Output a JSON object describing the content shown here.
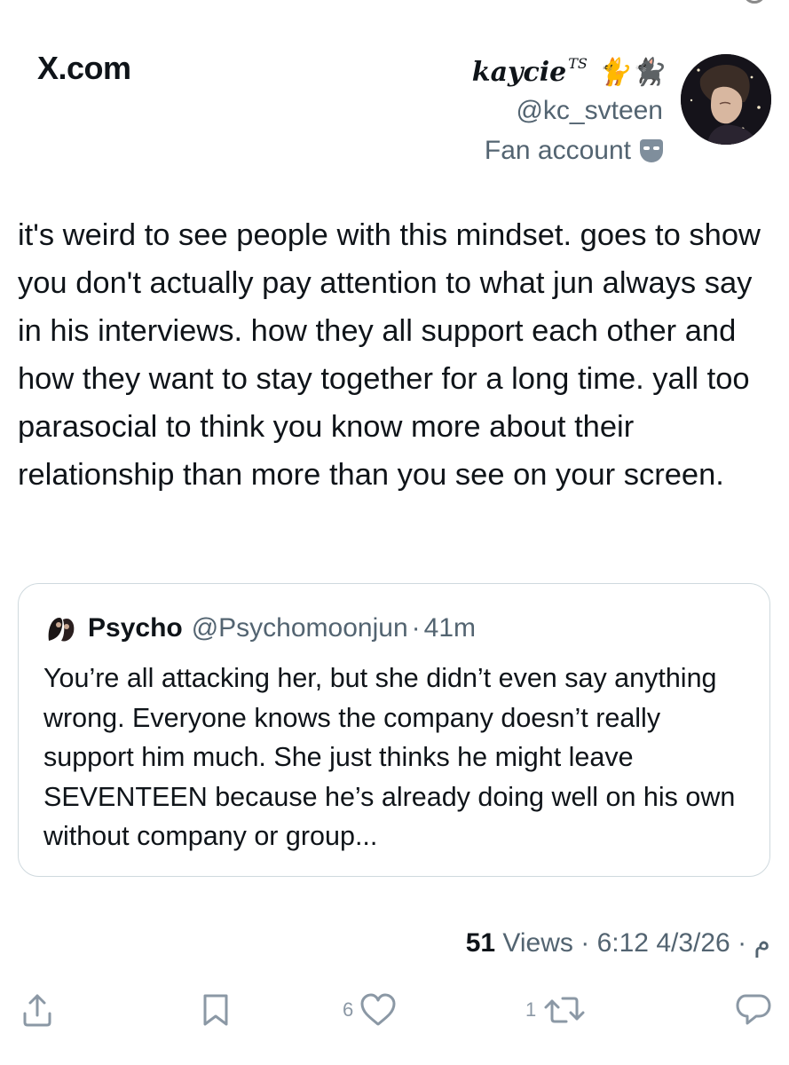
{
  "site": {
    "label": "X.com"
  },
  "author": {
    "display_name": "kaycie",
    "name_superscript": "TS",
    "name_emojis": "🐈🐈‍⬛",
    "handle": "@kc_svteen",
    "account_label": "Fan account"
  },
  "post": {
    "text": "it's weird to see people with this mindset. goes to show you don't actually pay attention to what jun always say in his interviews. how they all support each other and how they want to stay together for a long time. yall too parasocial to think you know more about their relationship than more than you see on your screen."
  },
  "quote": {
    "name": "Psycho",
    "handle": "@Psychomoonjun",
    "separator": "·",
    "time": "41m",
    "text": "You’re all attacking her, but she didn’t even say anything wrong. Everyone knows the company doesn’t really support him much. She just thinks he might leave SEVENTEEN because he’s already doing well on his own without company or group..."
  },
  "meta": {
    "views_count": "51",
    "views_label": "Views",
    "separator": "·",
    "time": "6:12 م",
    "date": "4/3/26"
  },
  "actions": {
    "likes_count": "6",
    "reposts_count": "1"
  },
  "colors": {
    "text_primary": "#0f1419",
    "text_secondary": "#536471",
    "border": "#cfd9de",
    "icon_gray": "#8b98a5"
  }
}
